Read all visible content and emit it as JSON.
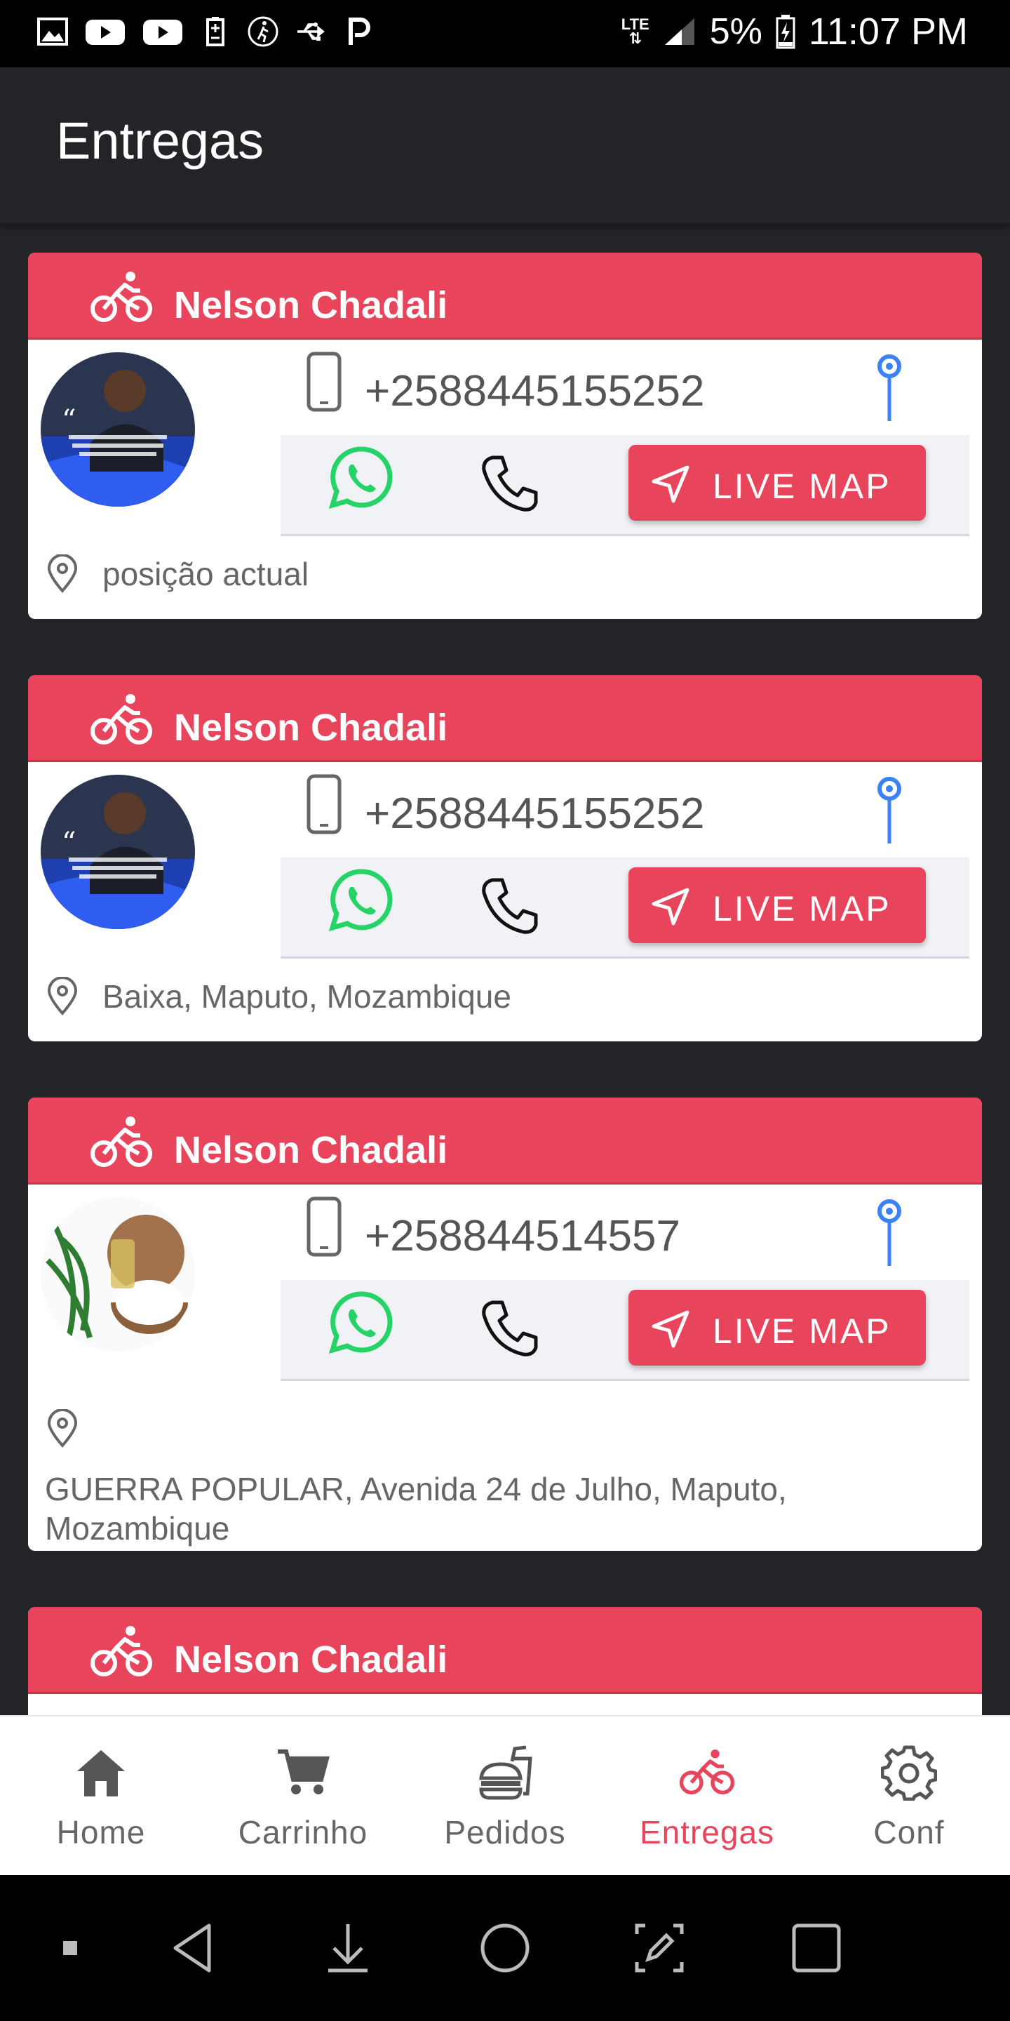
{
  "status_bar": {
    "network": "LTE",
    "battery": "5%",
    "time": "11:07 PM",
    "left_icons": [
      "image-icon",
      "youtube-icon",
      "youtube-icon",
      "battery-saver-icon",
      "walk-icon",
      "usb-icon",
      "p-icon"
    ]
  },
  "appbar": {
    "title": "Entregas"
  },
  "colors": {
    "accent": "#e8455c",
    "whatsapp": "#25d366",
    "pin": "#3b82f6",
    "appbar": "#222428"
  },
  "deliveries": [
    {
      "name": "Nelson Chadali",
      "phone": "+2588445155252",
      "address": "posição actual",
      "live_map_label": "LIVE MAP",
      "avatar": "portrait"
    },
    {
      "name": "Nelson Chadali",
      "phone": "+2588445155252",
      "address": "Baixa, Maputo, Mozambique",
      "live_map_label": "LIVE MAP",
      "avatar": "portrait"
    },
    {
      "name": "Nelson Chadali",
      "phone": "+258844514557",
      "address": "GUERRA POPULAR, Avenida 24 de Julho, Maputo, Mozambique",
      "live_map_label": "LIVE MAP",
      "avatar": "coconut"
    },
    {
      "name": "Nelson Chadali"
    }
  ],
  "bottom_nav": [
    {
      "label": "Home",
      "icon": "home-icon"
    },
    {
      "label": "Carrinho",
      "icon": "cart-icon"
    },
    {
      "label": "Pedidos",
      "icon": "fastfood-icon"
    },
    {
      "label": "Entregas",
      "icon": "bike-icon",
      "active": true
    },
    {
      "label": "Conf",
      "icon": "gear-icon"
    }
  ]
}
